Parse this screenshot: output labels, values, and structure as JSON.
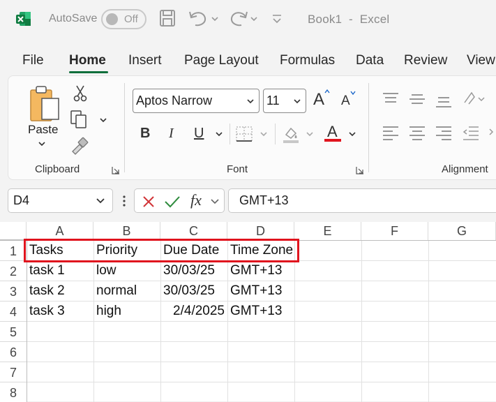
{
  "titlebar": {
    "autosave_label": "AutoSave",
    "autosave_state": "Off",
    "document_title": "Book1  -  Excel"
  },
  "tabs": [
    {
      "label": "File",
      "active": false
    },
    {
      "label": "Home",
      "active": true
    },
    {
      "label": "Insert",
      "active": false
    },
    {
      "label": "Page Layout",
      "active": false
    },
    {
      "label": "Formulas",
      "active": false
    },
    {
      "label": "Data",
      "active": false
    },
    {
      "label": "Review",
      "active": false
    },
    {
      "label": "View",
      "active": false
    }
  ],
  "ribbon": {
    "clipboard": {
      "paste_label": "Paste",
      "group_label": "Clipboard"
    },
    "font": {
      "font_name": "Aptos Narrow",
      "font_size": "11",
      "group_label": "Font",
      "bold": "B",
      "italic": "I",
      "underline": "U",
      "grow": "A",
      "shrink": "A",
      "font_color_letter": "A",
      "font_color": "#e0141e"
    },
    "alignment": {
      "group_label": "Alignment"
    }
  },
  "formula_bar": {
    "name_box": "D4",
    "fx_label": "fx",
    "formula": "GMT+13"
  },
  "grid": {
    "columns": [
      "A",
      "B",
      "C",
      "D",
      "E",
      "F",
      "G"
    ],
    "rows": [
      "1",
      "2",
      "3",
      "4",
      "5",
      "6",
      "7",
      "8"
    ],
    "cells": [
      [
        "Tasks",
        "Priority",
        "Due Date",
        "Time Zone"
      ],
      [
        "task 1",
        "low",
        "30/03/25",
        "GMT+13"
      ],
      [
        "task 2",
        "normal",
        "30/03/25",
        "GMT+13"
      ],
      [
        "task 3",
        "high",
        "2/4/2025",
        "GMT+13"
      ]
    ]
  },
  "colors": {
    "excel_green": "#107c41",
    "highlight_red": "#e0141e",
    "active_tab_underline": "#0f6e3b"
  }
}
